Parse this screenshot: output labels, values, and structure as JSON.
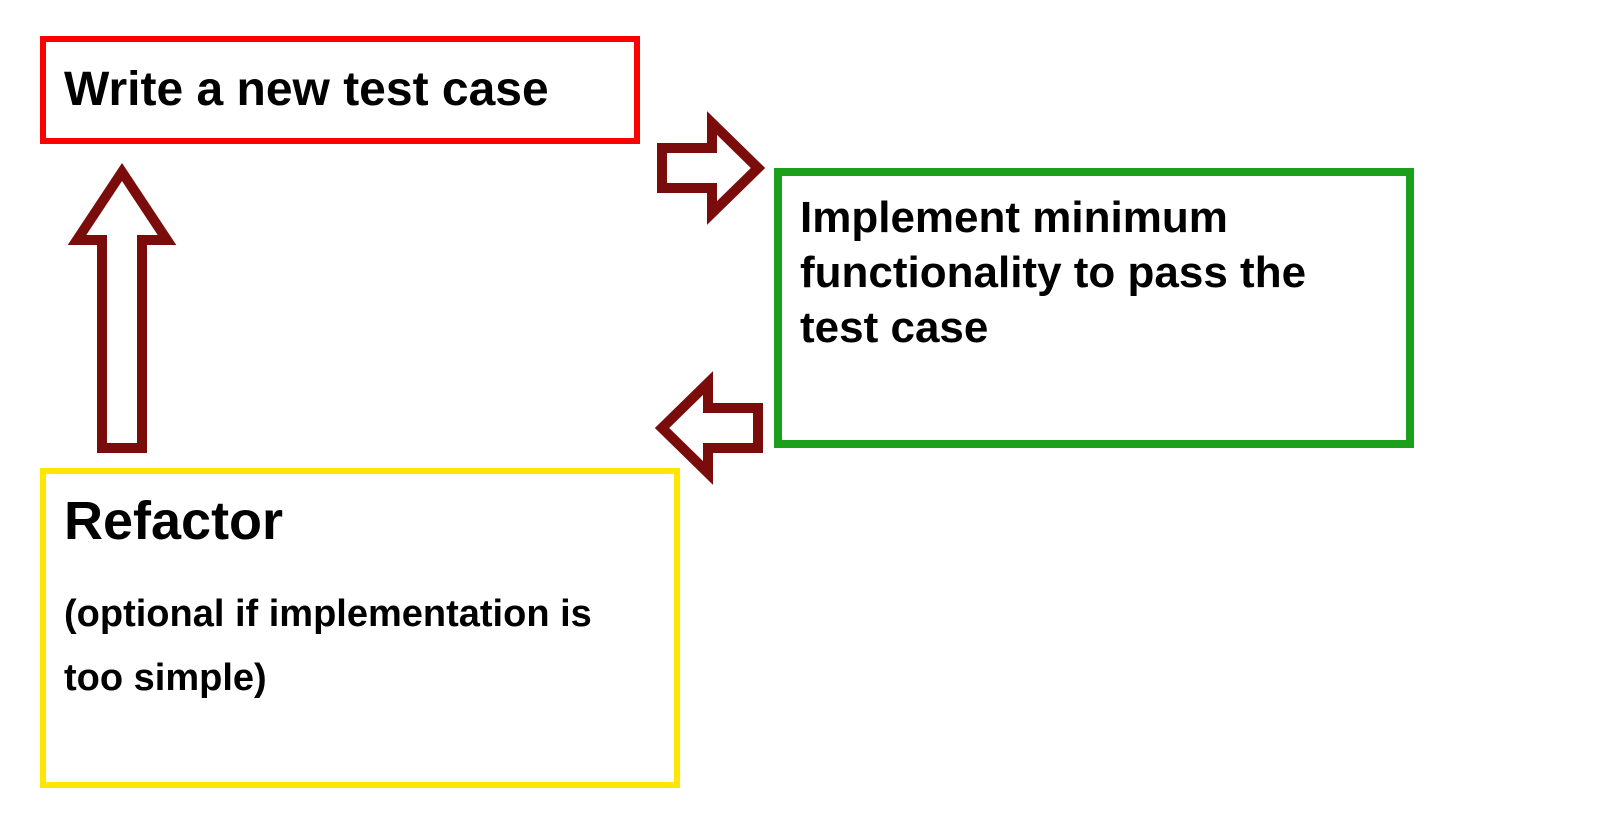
{
  "boxes": {
    "write": "Write a new test case",
    "implement": "Implement minimum functionality to pass the test case",
    "refactor_title": "Refactor",
    "refactor_sub": "(optional if implementation is too simple)"
  },
  "colors": {
    "box_red_border": "#ff0000",
    "box_green_border": "#1ca01c",
    "box_yellow_border": "#ffe600",
    "arrow_stroke": "#7a0c0c",
    "arrow_fill": "#ffffff"
  },
  "diagram": {
    "cycle": [
      "write",
      "implement",
      "refactor"
    ],
    "arrows": [
      {
        "from": "write",
        "to": "implement",
        "direction": "right"
      },
      {
        "from": "implement",
        "to": "refactor",
        "direction": "left"
      },
      {
        "from": "refactor",
        "to": "write",
        "direction": "up"
      }
    ]
  }
}
